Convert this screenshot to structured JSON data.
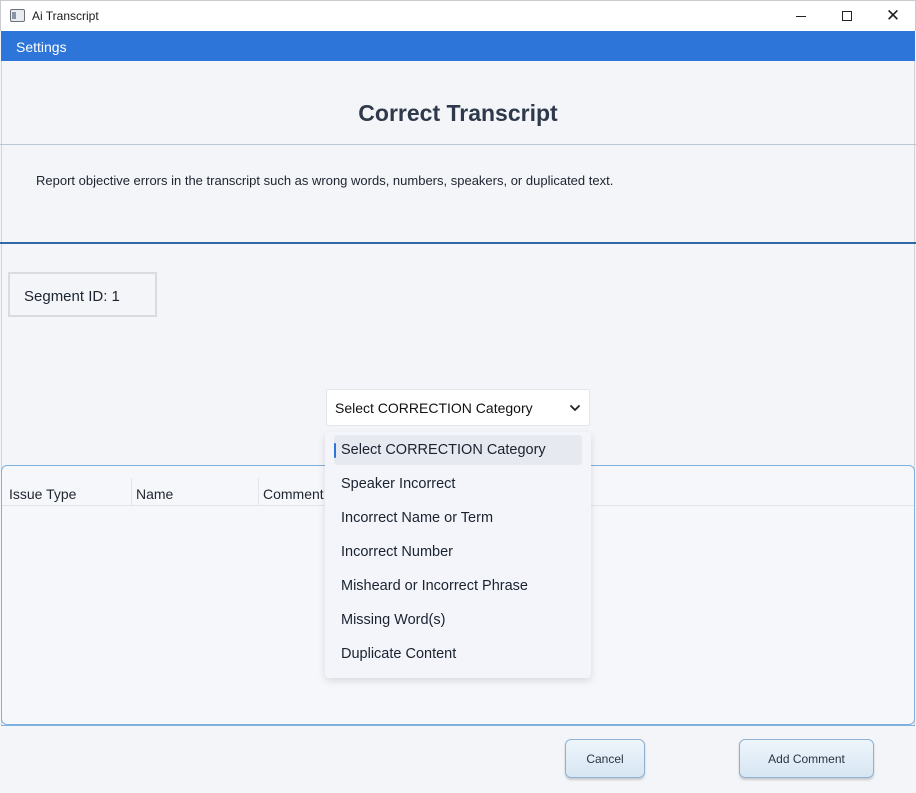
{
  "window": {
    "title": "Ai Transcript",
    "controls": {
      "minimize": "minimize",
      "maximize": "maximize",
      "close": "close"
    }
  },
  "menu": {
    "settings_label": "Settings"
  },
  "page": {
    "title": "Correct Transcript",
    "instructions": "Report objective errors in the transcript such as wrong words, numbers, speakers, or duplicated text."
  },
  "segment": {
    "label": "Segment ID: 1"
  },
  "category_select": {
    "selected": "Select CORRECTION Category",
    "options": [
      "Select CORRECTION Category",
      "Speaker Incorrect",
      "Incorrect Name or Term",
      "Incorrect Number",
      "Misheard or Incorrect Phrase",
      "Missing Word(s)",
      "Duplicate Content"
    ]
  },
  "table": {
    "columns": [
      "Issue Type",
      "Name",
      "Comment"
    ]
  },
  "buttons": {
    "cancel": "Cancel",
    "add_comment": "Add Comment"
  },
  "colors": {
    "accent": "#2d75d9",
    "panel_border": "#7fb1de"
  }
}
